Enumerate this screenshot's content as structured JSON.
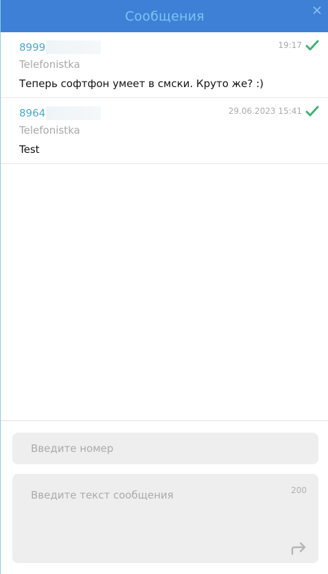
{
  "window": {
    "title": "Сообщения"
  },
  "messages": [
    {
      "number": "8999",
      "sender": "Telefonistka",
      "text": "Теперь софтфон умеет в смски. Круто же? :)",
      "time": "19:17",
      "status_icon": "double-check-icon"
    },
    {
      "number": "8964",
      "sender": "Telefonistka",
      "text": "Test",
      "time": "29.06.2023 15:41",
      "status_icon": "double-check-icon"
    }
  ],
  "compose": {
    "number_placeholder": "Введите номер",
    "number_value": "",
    "text_placeholder": "Введите текст сообщения",
    "text_value": "",
    "char_count": "200",
    "send_icon": "send-arrow-icon"
  },
  "colors": {
    "titlebar": "#3d80d6",
    "title_text": "#7ec4f0",
    "number_link": "#4aa8d0",
    "check_green": "#3cb371"
  }
}
